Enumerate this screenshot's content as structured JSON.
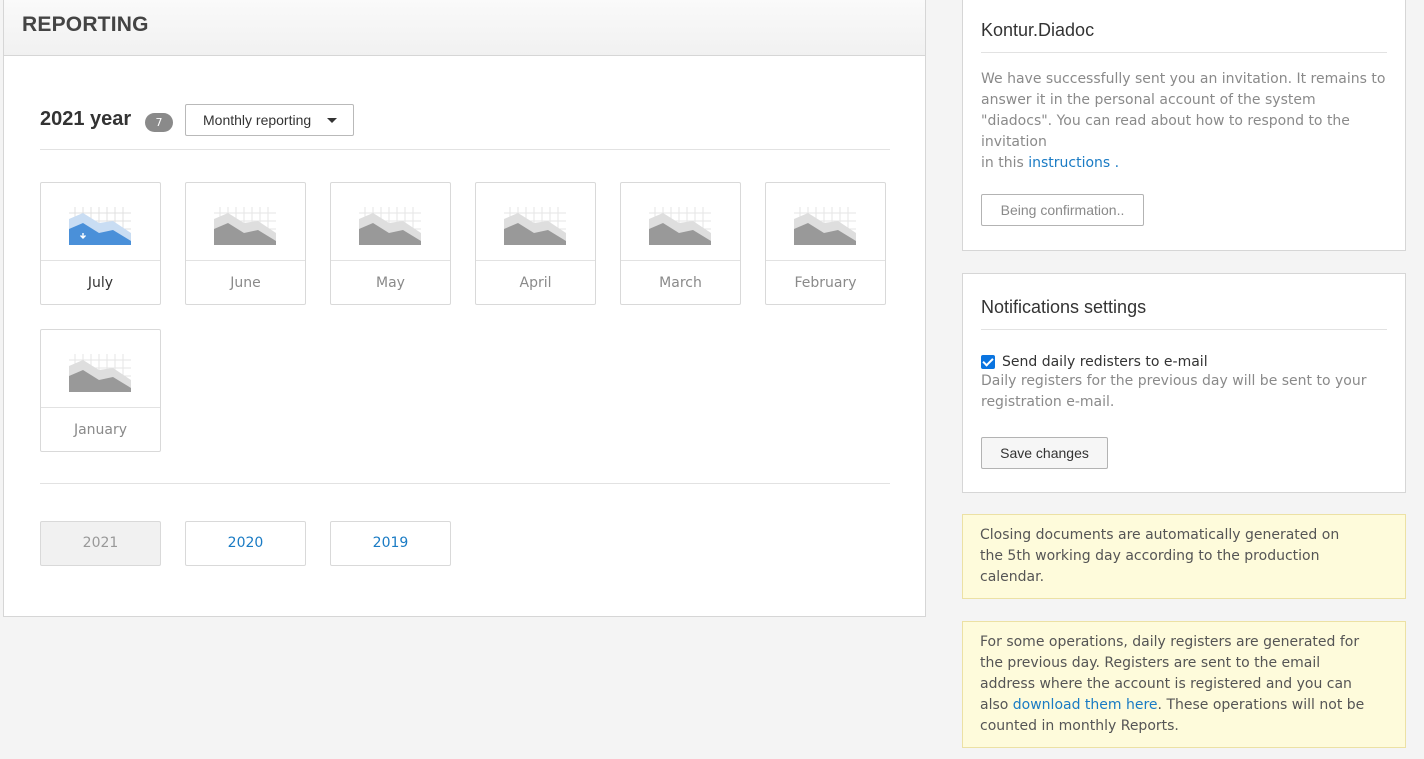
{
  "report": {
    "title": "REPORTING",
    "year_label": "2021 year",
    "badge_count": "7",
    "dropdown_label": "Monthly reporting",
    "months": [
      {
        "label": "July",
        "active": true
      },
      {
        "label": "June",
        "active": false
      },
      {
        "label": "May",
        "active": false
      },
      {
        "label": "April",
        "active": false
      },
      {
        "label": "March",
        "active": false
      },
      {
        "label": "February",
        "active": false
      },
      {
        "label": "January",
        "active": false
      }
    ],
    "years": [
      "2021",
      "2020",
      "2019"
    ]
  },
  "diadoc": {
    "title": "Kontur.Diadoc",
    "text": "We have successfully sent you an invitation. It remains to answer it in the personal account of the system \"diadocs\". You can read about how to respond to the invitation",
    "text_prefix": "in this",
    "link": "instructions",
    "text_suffix": ".",
    "button": "Being confirmation.."
  },
  "notifications": {
    "title": "Notifications settings",
    "checkbox_label": "Send daily redisters to e-mail",
    "checked": true,
    "description": "Daily registers for the previous day will be sent to your registration e-mail.",
    "save_button": "Save changes"
  },
  "notes": {
    "closing": "Closing documents are automatically generated on the 5th working day according to the production calendar.",
    "ops_prefix": "For some operations, daily registers are generated for the previous day. Registers are sent to the email address where the account is registered and you can also",
    "ops_link": "download them here",
    "ops_suffix": ". These operations will not be counted in monthly Reports."
  },
  "colors": {
    "accent": "#1a7bc4",
    "active_chart": "#4a90d9",
    "inactive_chart": "#999999",
    "note_bg": "#fefbdb"
  }
}
